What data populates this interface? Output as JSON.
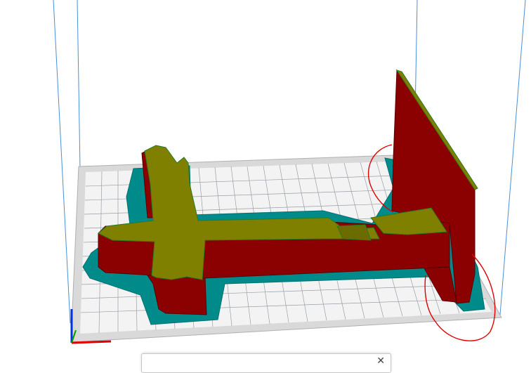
{
  "viewport": {
    "title": "",
    "colors": {
      "background": "#ffffff",
      "build_plate": "#d9d9d9",
      "build_plate_grid": "#9aa0a6",
      "build_volume_lines": "#4a90d9",
      "model_wall": "#8b0000",
      "model_top_surface": "#808000",
      "skirt_brim": "#008b8b",
      "annotation": "#e00000",
      "axis_x": "#e00000",
      "axis_y": "#00a000",
      "axis_z": "#0030e0"
    }
  },
  "notification": {
    "text": "",
    "close_icon": "close-icon",
    "close_glyph": "✕"
  }
}
